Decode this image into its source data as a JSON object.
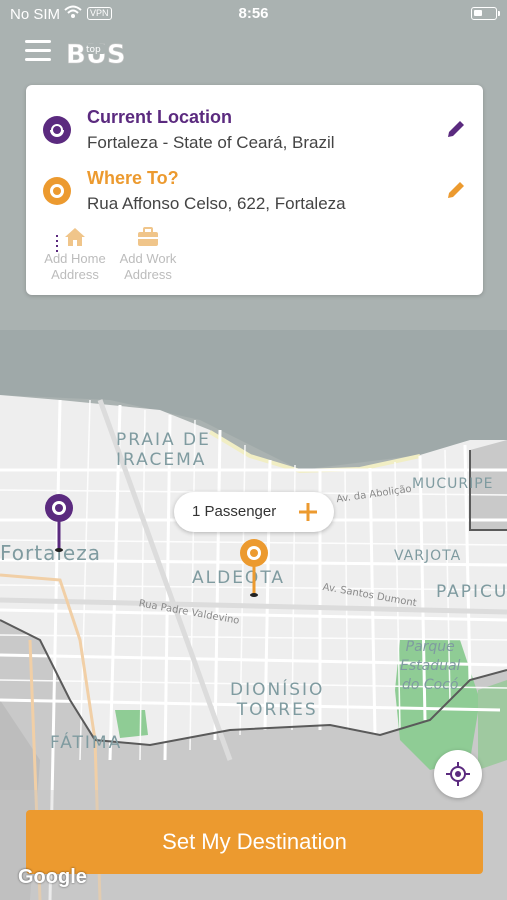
{
  "colors": {
    "brand_purple": "#5b2a7f",
    "brand_orange": "#ec9a2f",
    "cta_background": "#ec9a2f"
  },
  "status_bar": {
    "carrier": "No SIM",
    "vpn": "VPN",
    "time": "8:56",
    "wifi_icon": "wifi-icon",
    "battery_icon": "battery-icon"
  },
  "header": {
    "menu_icon": "hamburger-menu-icon",
    "logo_text_big": "BUS",
    "logo_text_small": "top"
  },
  "route_card": {
    "origin": {
      "title": "Current Location",
      "value": "Fortaleza - State of Ceará, Brazil",
      "icon": "origin-marker-icon",
      "edit_icon": "pencil-icon"
    },
    "destination": {
      "title": "Where To?",
      "value": "Rua Affonso Celso, 622, Fortaleza",
      "icon": "destination-marker-icon",
      "edit_icon": "pencil-icon"
    },
    "shortcuts": [
      {
        "label_line1": "Add Home",
        "label_line2": "Address",
        "icon": "home-icon"
      },
      {
        "label_line1": "Add Work",
        "label_line2": "Address",
        "icon": "briefcase-icon"
      }
    ]
  },
  "map": {
    "labels": {
      "praia_line1": "PRAIA DE",
      "praia_line2": "IRACEMA",
      "mucuripe": "MUCURIPE",
      "fortaleza": "Fortaleza",
      "aldeota": "ALDEOTA",
      "varjota": "VARJOTA",
      "papicu": "PAPICU",
      "dionisio_line1": "DIONÍSIO",
      "dionisio_line2": "TORRES",
      "fatima": "FÁTIMA",
      "park_line1": "Parque",
      "park_line2": "Estadual",
      "park_line3": "do Cocó",
      "street_abolicao": "Av. da Abolição",
      "street_santos_dumont": "Av. Santos Dumont",
      "street_padre_valdevino": "Rua Padre Valdevino"
    },
    "passenger_pill": {
      "label": "1 Passenger",
      "add_icon": "plus-icon"
    },
    "locate_icon": "crosshair-locate-icon",
    "google_attribution": "Google"
  },
  "cta": {
    "label": "Set My Destination"
  }
}
